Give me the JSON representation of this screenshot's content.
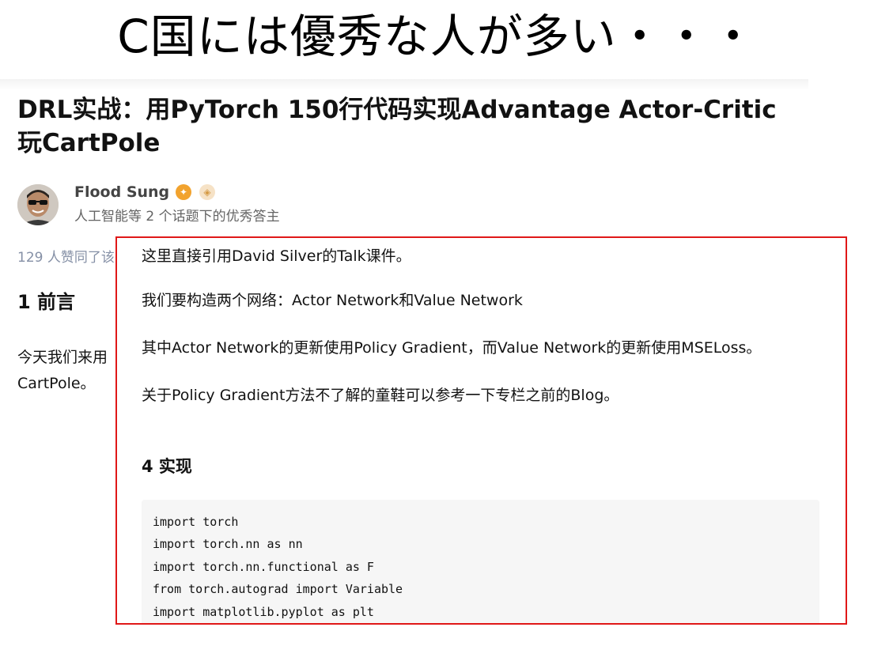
{
  "slide": {
    "title": "C国には優秀な人が多い・・・"
  },
  "article": {
    "title_line1": "DRL实战：用PyTorch 150行代码实现Advantage Actor-Critic",
    "title_line2": "玩CartPole",
    "author": {
      "name": "Flood Sung",
      "description": "人工智能等 2 个话题下的优秀答主",
      "badge1_icon": "excellent-answerer-icon",
      "badge2_icon": "org-certified-icon"
    },
    "likes_text": "129 人赞同了该",
    "section_heading": "1 前言",
    "intro_line1": "今天我们来用",
    "intro_line2": "CartPole。"
  },
  "popup": {
    "para1": "这里直接引用David Silver的Talk课件。",
    "para2": "我们要构造两个网络：Actor Network和Value Network",
    "para3": "其中Actor Network的更新使用Policy Gradient，而Value Network的更新使用MSELoss。",
    "para4": "关于Policy Gradient方法不了解的童鞋可以参考一下专栏之前的Blog。",
    "heading": "4 实现",
    "code": [
      "import torch",
      "import torch.nn as nn",
      "import torch.nn.functional as F",
      "from torch.autograd import Variable",
      "import matplotlib.pyplot as plt"
    ],
    "border_color": "#e01818"
  }
}
